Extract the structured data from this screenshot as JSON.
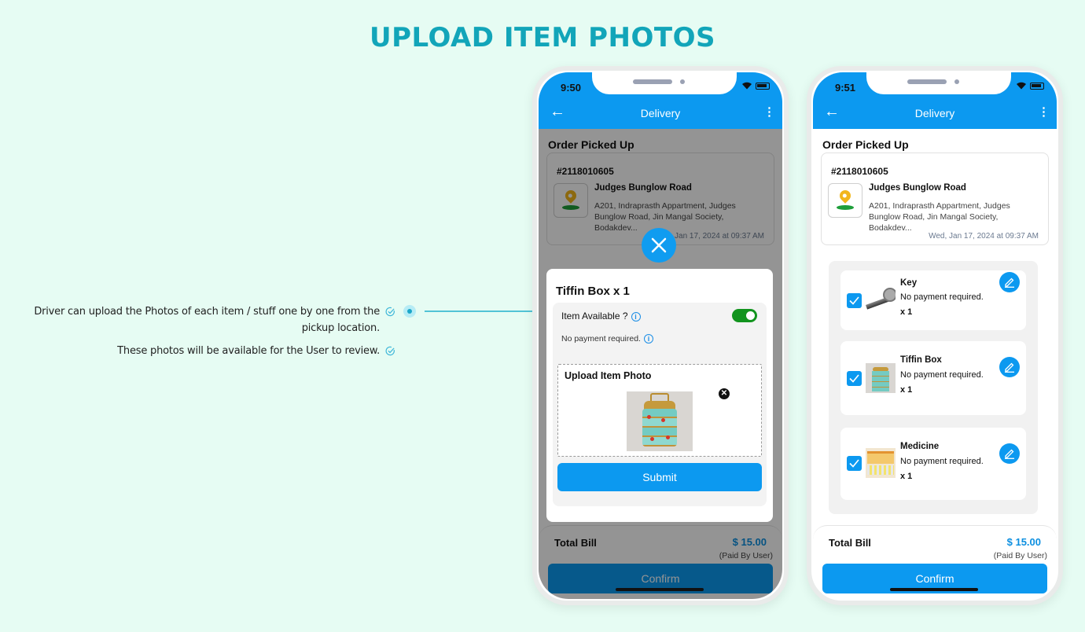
{
  "page": {
    "title": "UPLOAD ITEM PHOTOS",
    "features": [
      "Driver can upload the Photos of each item / stuff one by one from the pickup location.",
      "These photos will be available for the User to review."
    ]
  },
  "colors": {
    "background": "#e6fcf3",
    "title": "#12a5b9",
    "primary": "#0c99f0",
    "toggle_on": "#12941e",
    "amount": "#0c8fe0"
  },
  "phone1": {
    "time": "9:50",
    "header": "Delivery",
    "section": "Order Picked Up",
    "order": {
      "id": "#2118010605",
      "address_title": "Judges Bunglow Road",
      "address": "A201, Indraprasth Appartment, Judges Bunglow Road, Jin Mangal Society, Bodakdev...",
      "date": "Wed, Jan 17, 2024 at 09:37 AM"
    },
    "modal": {
      "title": "Tiffin Box  x 1",
      "item_available_label": "Item Available ?",
      "item_available": true,
      "payment_note": "No payment required.",
      "upload_label": "Upload Item Photo",
      "submit_label": "Submit"
    },
    "total_label": "Total Bill",
    "total_amount": "$ 15.00",
    "paid_by": "(Paid By User)",
    "confirm_label": "Confirm"
  },
  "phone2": {
    "time": "9:51",
    "header": "Delivery",
    "section": "Order Picked Up",
    "order": {
      "id": "#2118010605",
      "address_title": "Judges Bunglow Road",
      "address": "A201, Indraprasth Appartment, Judges Bunglow Road, Jin Mangal Society, Bodakdev...",
      "date": "Wed, Jan 17, 2024 at 09:37 AM"
    },
    "items": [
      {
        "name": "Key",
        "payment": "No payment required.",
        "qty": "x 1",
        "checked": true,
        "thumb": "key"
      },
      {
        "name": "Tiffin Box",
        "payment": "No payment required.",
        "qty": "x 1",
        "checked": true,
        "thumb": "tiffin"
      },
      {
        "name": "Medicine",
        "payment": "No payment required.",
        "qty": "x 1",
        "checked": true,
        "thumb": "medicine"
      }
    ],
    "total_label": "Total Bill",
    "total_amount": "$ 15.00",
    "paid_by": "(Paid By User)",
    "confirm_label": "Confirm"
  }
}
